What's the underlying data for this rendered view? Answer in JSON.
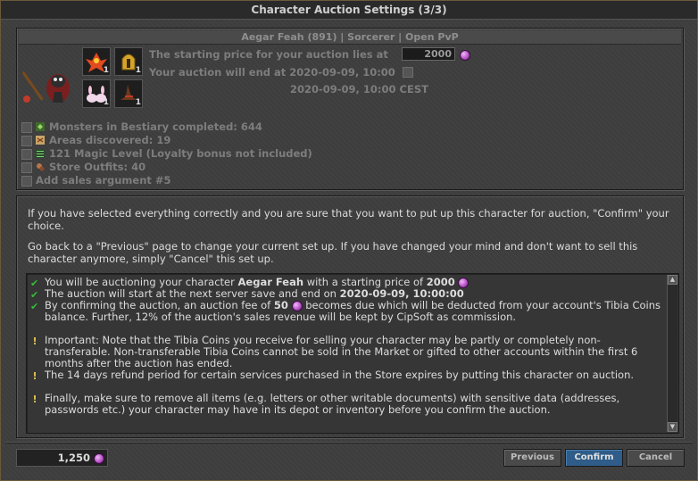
{
  "window": {
    "title": "Character Auction Settings (3/3)"
  },
  "header": {
    "character_line": "Aegar Feah (891) | Sorcerer | Open PvP"
  },
  "items": [
    {
      "icon": "phoenix-icon",
      "count": "1"
    },
    {
      "icon": "golden-helmet-icon",
      "count": "1"
    },
    {
      "icon": "bunny-slippers-icon",
      "count": "1"
    },
    {
      "icon": "witch-hat-icon",
      "count": "1"
    }
  ],
  "price": {
    "label": "The starting price for your auction lies at",
    "value": "2000"
  },
  "end": {
    "label": "Your auction will end at 2020-09-09, 10:00",
    "cest": "2020-09-09, 10:00 CEST"
  },
  "arguments": [
    {
      "icon": "bestiary-icon",
      "text": "Monsters in Bestiary completed: 644"
    },
    {
      "icon": "map-icon",
      "text": "Areas discovered: 19"
    },
    {
      "icon": "magic-level-icon",
      "text": "121 Magic Level (Loyalty bonus not included)"
    },
    {
      "icon": "outfit-icon",
      "text": "Store Outfits: 40"
    },
    {
      "icon": "",
      "text": "Add sales argument #5"
    }
  ],
  "info": {
    "para1": "If you have selected everything correctly and you are sure that you want to put up this character for auction, \"Confirm\" your choice.",
    "para2": "Go back to a \"Previous\" page to change your current set up. If you have changed your mind and don't want to sell this character anymore, simply \"Cancel\" this set up."
  },
  "summary": {
    "line1_pre": "You will be auctioning your character ",
    "line1_name": "Aegar Feah",
    "line1_mid": " with a starting price of ",
    "line1_price": "2000",
    "line2_pre": "The auction will start at the next server save and end on ",
    "line2_date": "2020-09-09, 10:00:00",
    "line3_pre": "By confirming the auction, an auction fee of ",
    "line3_fee": "50",
    "line3_post": " becomes due which will be deducted from your account's Tibia Coins balance. Further, 12% of the auction's sales revenue will be kept by CipSoft as commission.",
    "line4": "Important: Note that the Tibia Coins you receive for selling your character may be partly or completely non-transferable. Non-transferable Tibia Coins cannot be sold in the Market or gifted to other accounts within the first 6 months after the auction has ended.",
    "line5": "The 14 days refund period for certain services purchased in the Store expires by putting this character on auction.",
    "line6": "Finally, make sure to remove all items (e.g. letters or other writable documents) with sensitive data (addresses, passwords etc.) your character may have in its depot or inventory before you confirm the auction."
  },
  "footer": {
    "balance": "1,250",
    "previous": "Previous",
    "confirm": "Confirm",
    "cancel": "Cancel"
  },
  "colors": {
    "accent": "#2f5c88",
    "check": "#37b83a",
    "warning": "#e0c350",
    "coin": "#b04cc0"
  }
}
